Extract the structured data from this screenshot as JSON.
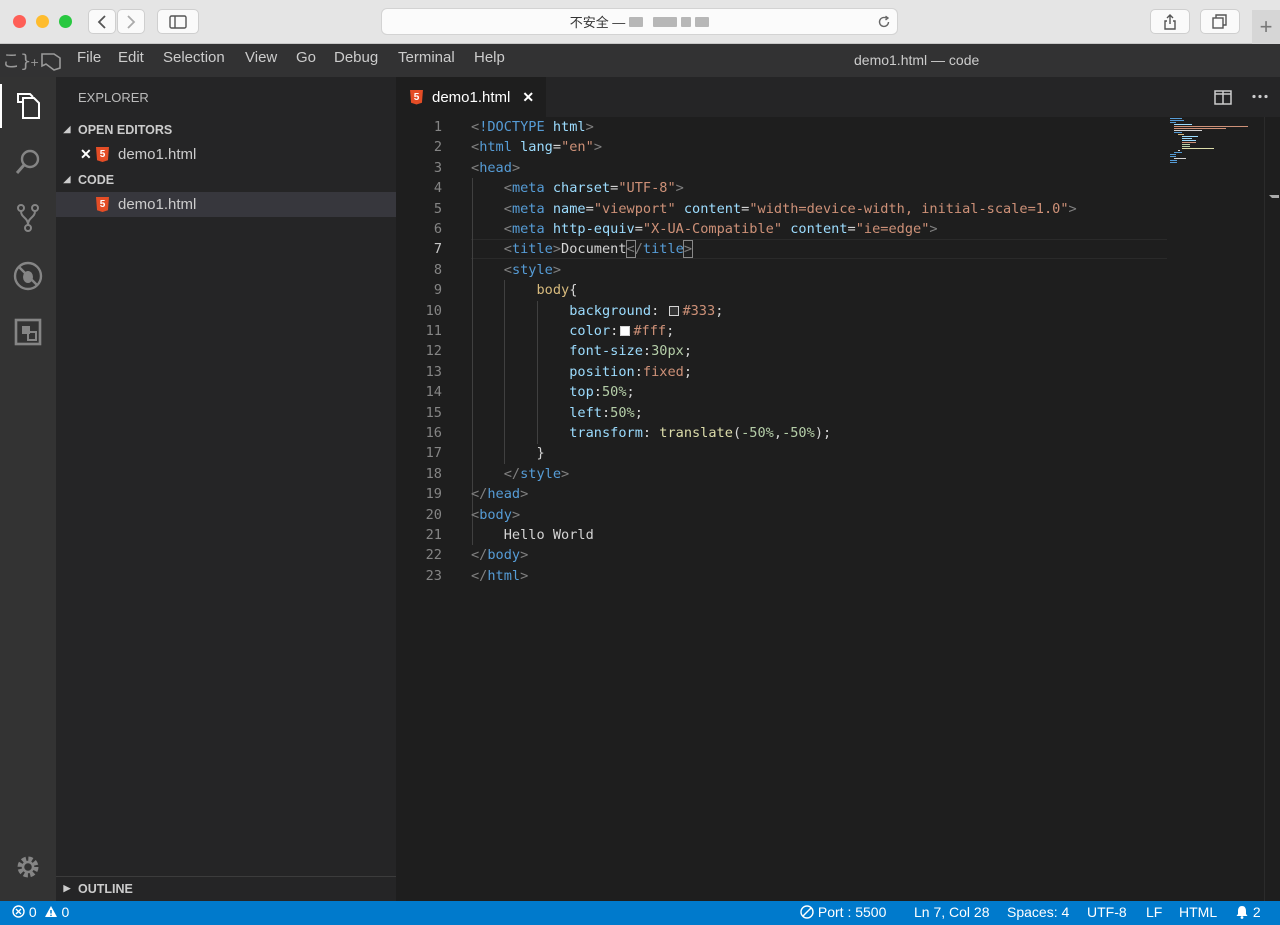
{
  "browser": {
    "url_prefix": "不安全 —",
    "new_tab_symbol": "+"
  },
  "window": {
    "title": "demo1.html — code"
  },
  "menu": [
    "File",
    "Edit",
    "Selection",
    "View",
    "Go",
    "Debug",
    "Terminal",
    "Help"
  ],
  "sidebar": {
    "header": "EXPLORER",
    "open_editors_label": "OPEN EDITORS",
    "open_editors": [
      {
        "name": "demo1.html"
      }
    ],
    "folder_label": "CODE",
    "folder_files": [
      {
        "name": "demo1.html"
      }
    ],
    "outline_label": "OUTLINE"
  },
  "activity_icons": [
    "files-icon",
    "search-icon",
    "source-control-icon",
    "debug-icon",
    "extensions-icon",
    "gear-icon"
  ],
  "editor": {
    "tab_label": "demo1.html",
    "line_numbers": [
      "1",
      "2",
      "3",
      "4",
      "5",
      "6",
      "7",
      "8",
      "9",
      "10",
      "11",
      "12",
      "13",
      "14",
      "15",
      "16",
      "17",
      "18",
      "19",
      "20",
      "21",
      "22",
      "23"
    ],
    "current_line": 7
  },
  "status": {
    "errors": "0",
    "warnings": "0",
    "port": "Port : 5500",
    "position": "Ln 7, Col 28",
    "spaces": "Spaces: 4",
    "encoding": "UTF-8",
    "eol": "LF",
    "language": "HTML",
    "notifications": "2"
  },
  "colors": {
    "accent": "#007acc",
    "editor_bg": "#1e1e1e",
    "sidebar_bg": "#252526",
    "activity_bg": "#333333"
  }
}
